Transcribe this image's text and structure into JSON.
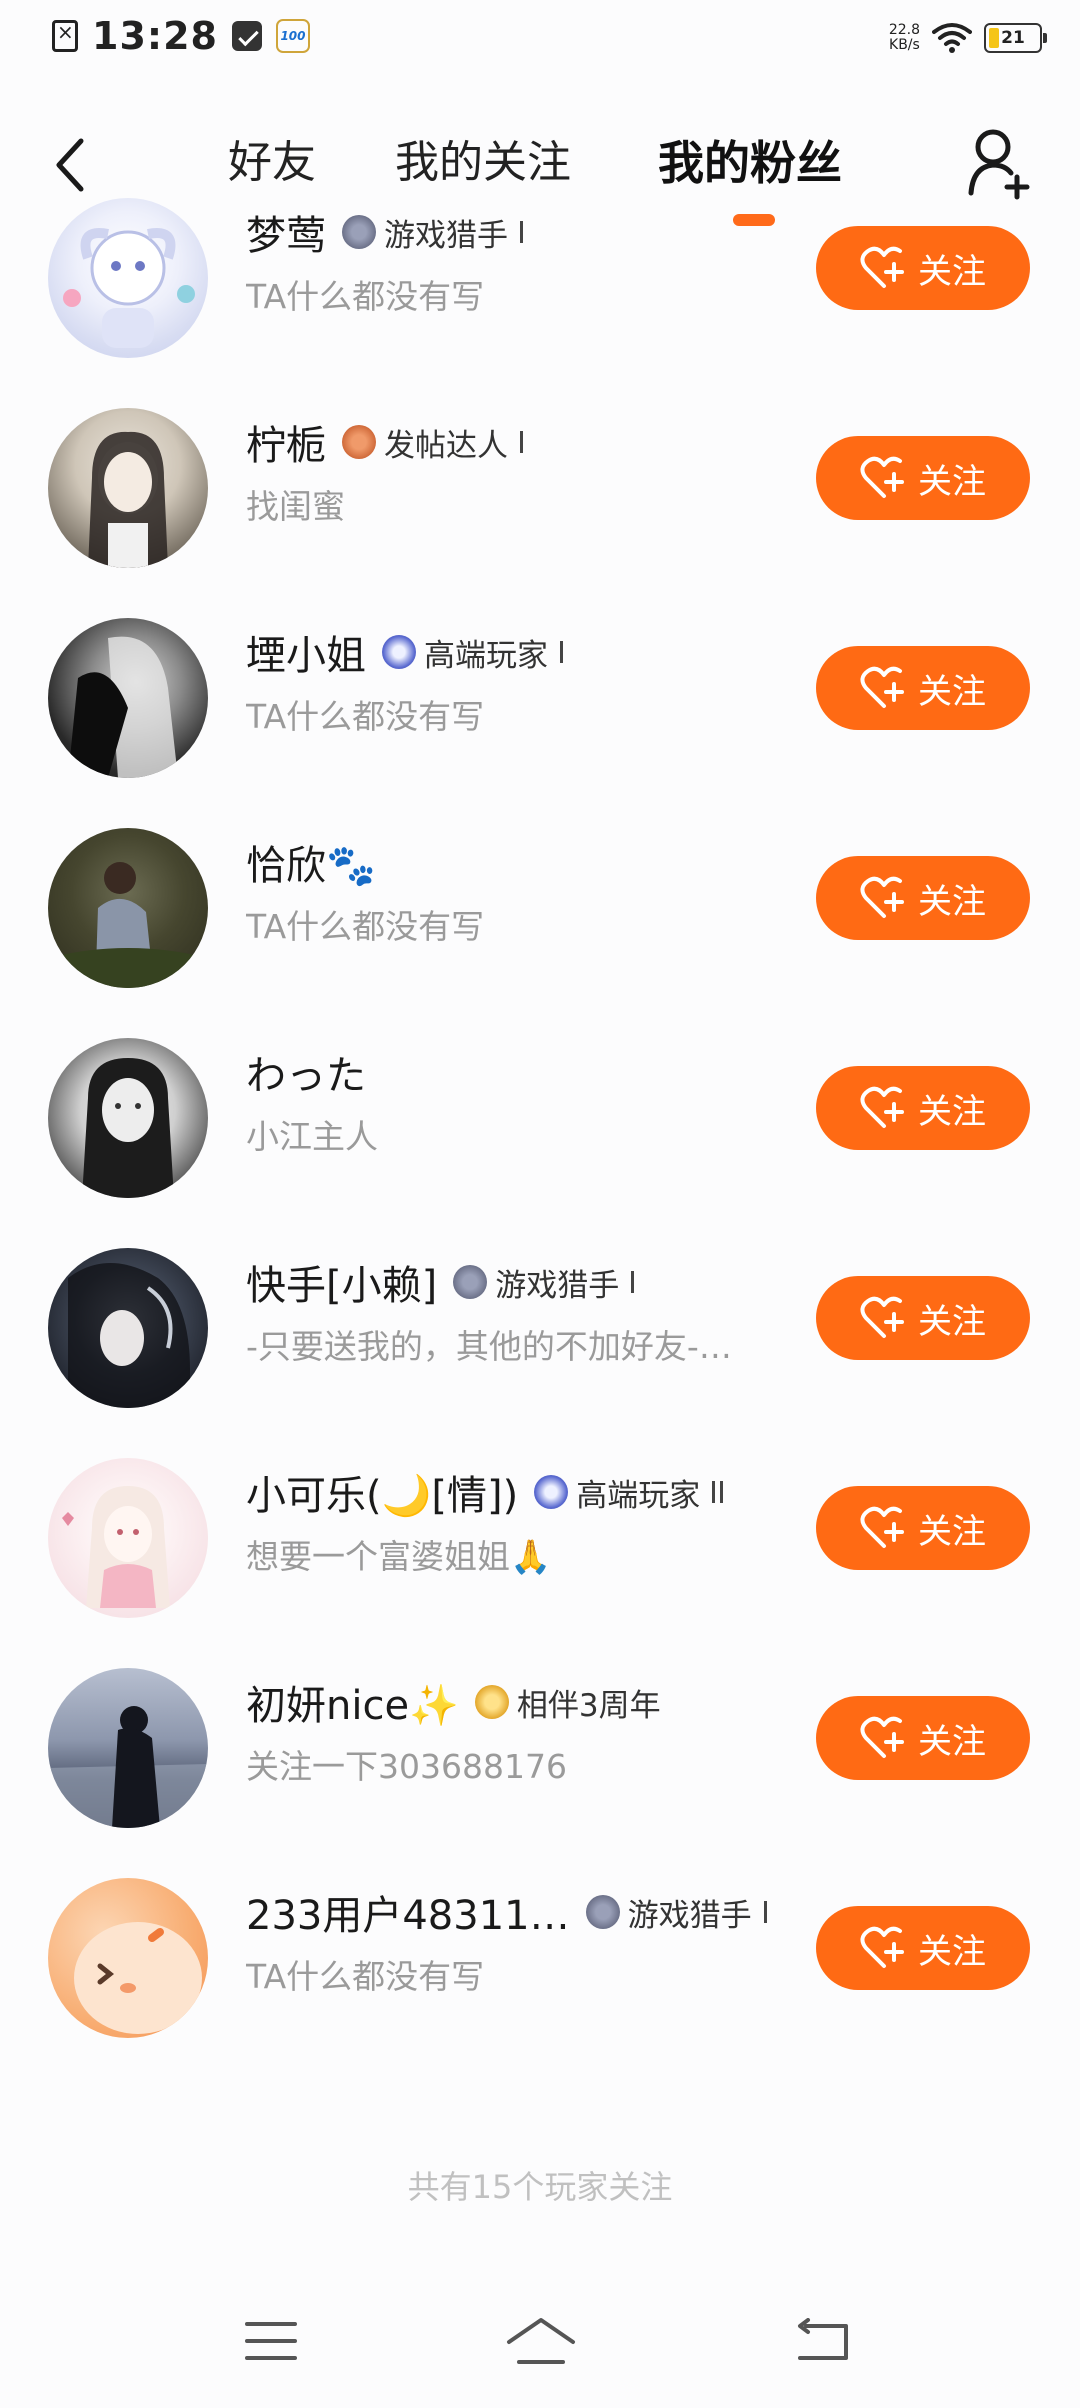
{
  "status_bar": {
    "time": "13:28",
    "net_speed_value": "22.8",
    "net_speed_unit": "KB/s",
    "battery": "21",
    "battery_level": 0.21,
    "app_badge": "100"
  },
  "header": {
    "tabs": [
      {
        "label": "好友",
        "active": false
      },
      {
        "label": "我的关注",
        "active": false
      },
      {
        "label": "我的粉丝",
        "active": true
      }
    ],
    "accent": "#ff6a1a"
  },
  "follow_label": "关注",
  "fans": [
    {
      "name": "梦莺",
      "badge": "游戏猎手",
      "badge_level": "I",
      "bio": "TA什么都没有写"
    },
    {
      "name": "柠栀",
      "badge": "发帖达人",
      "badge_level": "I",
      "bio": "找闺蜜"
    },
    {
      "name": "堙小姐",
      "badge": "高端玩家",
      "badge_level": "I",
      "bio": "TA什么都没有写"
    },
    {
      "name": "恰欣🐾",
      "badge": "",
      "badge_level": "",
      "bio": "TA什么都没有写"
    },
    {
      "name": "わった",
      "badge": "",
      "badge_level": "",
      "bio": "小江主人"
    },
    {
      "name": "快手[小赖]",
      "badge": "游戏猎手",
      "badge_level": "I",
      "bio": "-只要送我的，其他的不加好友-…"
    },
    {
      "name": "小可乐(🌙[情])",
      "badge": "高端玩家",
      "badge_level": "II",
      "bio": "想要一个富婆姐姐🙏"
    },
    {
      "name": "初妍nice✨",
      "badge": "相伴3周年",
      "badge_level": "",
      "bio": "关注一下303688176"
    },
    {
      "name": "233用户48311…",
      "badge": "游戏猎手",
      "badge_level": "I",
      "bio": "TA什么都没有写"
    }
  ],
  "footer": "共有15个玩家关注",
  "colors": {
    "follow_button": "#ff6a14",
    "bio_text": "#9a9a9a",
    "footer_text": "#c0c0c0"
  }
}
